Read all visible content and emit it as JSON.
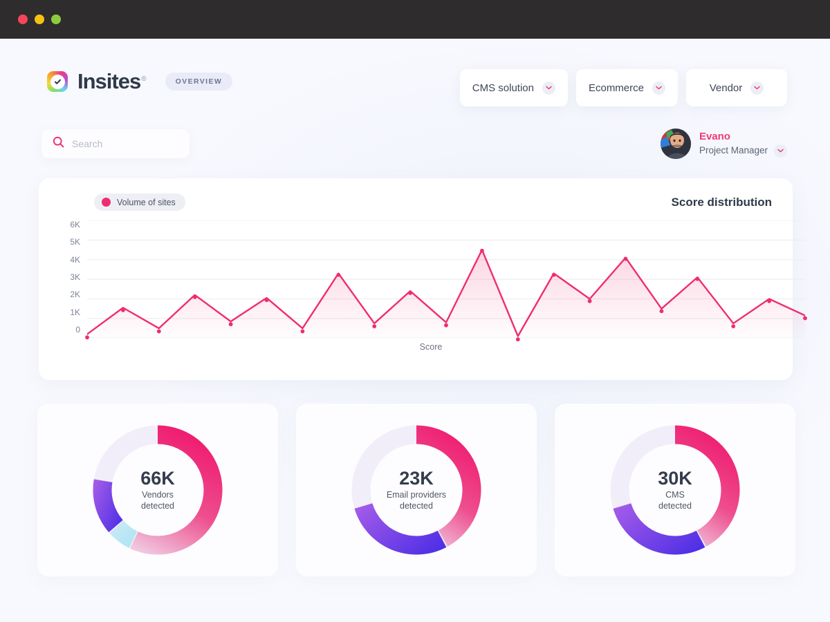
{
  "window": {
    "buttons": [
      "close",
      "minimize",
      "maximize"
    ]
  },
  "header": {
    "logo_text": "Insites",
    "logo_registered": "®",
    "logo_icon": "check-badge-icon",
    "overview_badge": "OVERVIEW",
    "filters": [
      {
        "label": "CMS solution",
        "icon": "chevron-down-icon"
      },
      {
        "label": "Ecommerce",
        "icon": "chevron-down-icon"
      },
      {
        "label": "Vendor",
        "icon": "chevron-down-icon"
      }
    ]
  },
  "search": {
    "icon": "search-icon",
    "placeholder": "Search",
    "value": ""
  },
  "user": {
    "name": "Evano",
    "role": "Project Manager",
    "avatar_icon": "user-avatar",
    "chevron_icon": "chevron-down-icon"
  },
  "chart_card": {
    "legend_label": "Volume of sites",
    "legend_color": "#ef2d6d",
    "title": "Score distribution"
  },
  "chart_data": {
    "type": "area",
    "title": "Score distribution",
    "xlabel": "Score",
    "ylabel": "",
    "ylim": [
      0,
      6000
    ],
    "ytick_labels": [
      "6K",
      "5K",
      "4K",
      "3K",
      "2K",
      "1K",
      "0"
    ],
    "ytick_values": [
      6000,
      5000,
      4000,
      3000,
      2000,
      1000,
      0
    ],
    "grid": true,
    "legend_position": "top-left",
    "series": [
      {
        "name": "Volume of sites",
        "color": "#ef2d6d",
        "values": [
          200,
          1550,
          500,
          2200,
          850,
          2050,
          500,
          3300,
          750,
          2400,
          800,
          4500,
          100,
          3300,
          2000,
          4100,
          1500,
          3100,
          750,
          2000,
          1150
        ]
      }
    ],
    "x": [
      1,
      2,
      3,
      4,
      5,
      6,
      7,
      8,
      9,
      10,
      11,
      12,
      13,
      14,
      15,
      16,
      17,
      18,
      19,
      20,
      21
    ]
  },
  "donuts": [
    {
      "value": "66K",
      "label": "Vendors\ndetected",
      "label_line1": "Vendors",
      "label_line2": "detected",
      "segments": [
        {
          "name": "primary",
          "percent": 57,
          "color": "#ef2d6d"
        },
        {
          "name": "accent",
          "percent": 6,
          "color": "#9ce0f0"
        },
        {
          "name": "secondary",
          "percent": 14,
          "color": "#8b4ce0"
        }
      ]
    },
    {
      "value": "23K",
      "label": "Email providers\ndetected",
      "label_line1": "Email providers",
      "label_line2": "detected",
      "segments": [
        {
          "name": "primary",
          "percent": 42,
          "color": "#ef2d6d"
        },
        {
          "name": "secondary",
          "percent": 28,
          "color": "#5b3ce8"
        }
      ]
    },
    {
      "value": "30K",
      "label": "CMS\ndetected",
      "label_line1": "CMS",
      "label_line2": "detected",
      "segments": [
        {
          "name": "primary",
          "percent": 42,
          "color": "#ef2d6d"
        },
        {
          "name": "secondary",
          "percent": 28,
          "color": "#5b3ce8"
        }
      ]
    }
  ],
  "colors": {
    "accent_pink": "#ef2d6d",
    "accent_purple": "#8b4ce0",
    "background": "#f8f9fe",
    "card": "#ffffff",
    "text_dark": "#2f3a4a"
  }
}
